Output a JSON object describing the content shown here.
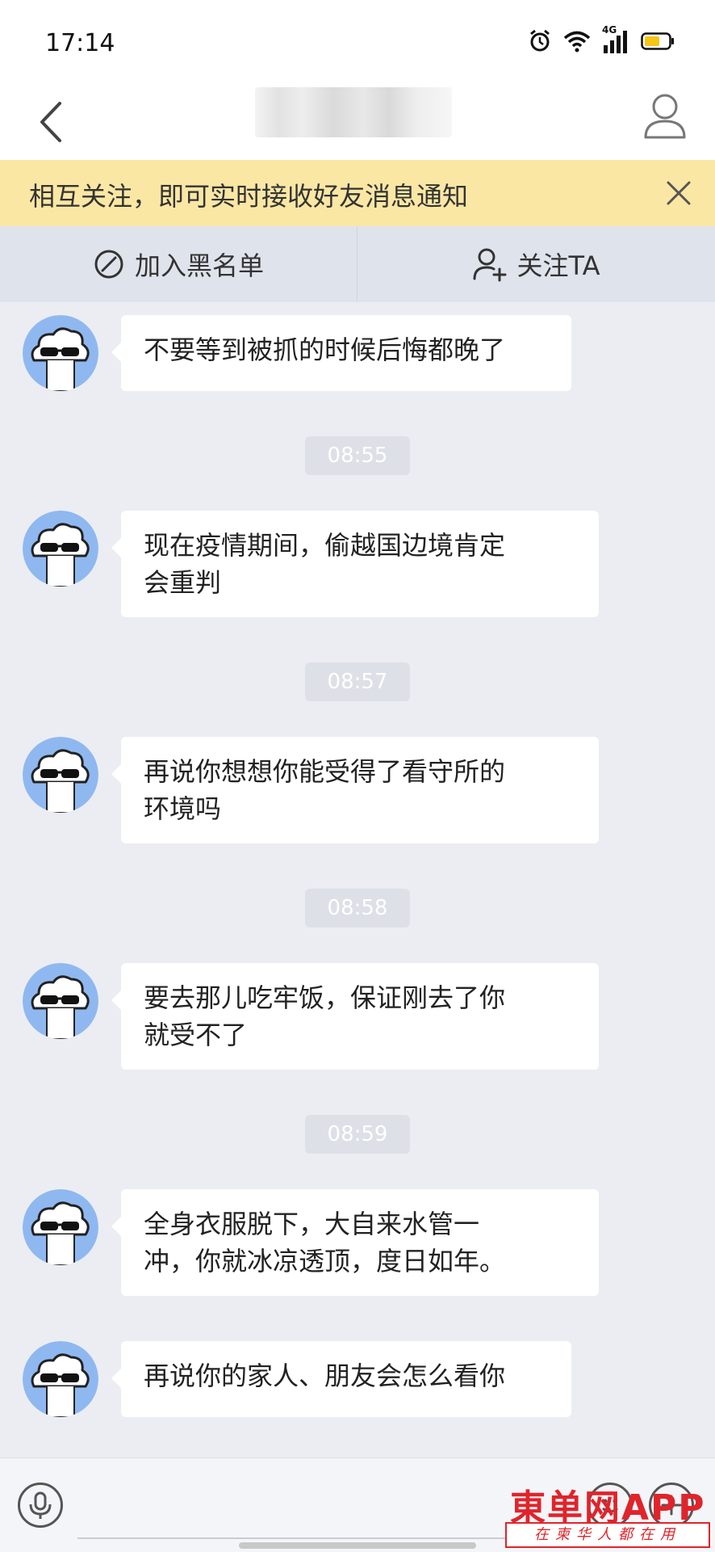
{
  "status_bar": {
    "time": "17:14",
    "network": "4G"
  },
  "notice": {
    "text": "相互关注，即可实时接收好友消息通知"
  },
  "actions": {
    "blacklist_label": "加入黑名单",
    "follow_label": "关注TA"
  },
  "messages": [
    {
      "text": "不要等到被抓的时候后悔都晚了"
    },
    {
      "time": "08:55"
    },
    {
      "text": "现在疫情期间，偷越国边境肯定\n会重判"
    },
    {
      "time": "08:57"
    },
    {
      "text": "再说你想想你能受得了看守所的\n环境吗"
    },
    {
      "time": "08:58"
    },
    {
      "text": "要去那儿吃牢饭，保证刚去了你\n就受不了"
    },
    {
      "time": "08:59"
    },
    {
      "text": "全身衣服脱下，大自来水管一\n冲，你就冰凉透顶，度日如年。"
    },
    {
      "text": "再说你的家人、朋友会怎么看你"
    }
  ],
  "watermark": {
    "brand": "東单网APP",
    "slogan": "在柬华人都在用"
  },
  "colors": {
    "notice_bg": "#fbe7a4",
    "actions_bg": "#dfe3ec",
    "chat_bg": "#ebedf2",
    "avatar_bg": "#8fb8f0",
    "watermark": "#e0242b"
  },
  "icons": [
    "back-icon",
    "profile-icon",
    "close-icon",
    "block-icon",
    "add-user-icon",
    "voice-icon",
    "emoji-icon",
    "plus-icon"
  ]
}
